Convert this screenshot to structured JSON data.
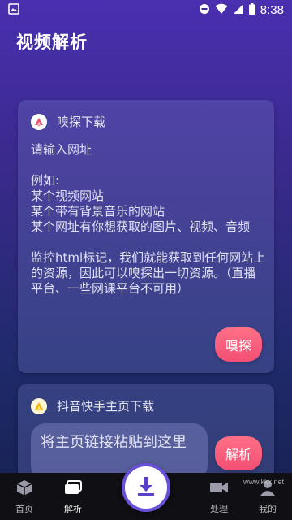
{
  "status_bar": {
    "time": "8:38"
  },
  "header": {
    "title": "视频解析"
  },
  "sniff_card": {
    "title": "嗅探下载",
    "body": "请输入网址\n\n例如:\n某个视频网站\n某个带有背景音乐的网站\n某个网址有你想获取的图片、视频、音频\n\n监控html标记，我们就能获取到任何网站上的资源，因此可以嗅探出一切资源。（直播平台、一些网课平台不可用）",
    "button_label": "嗅探"
  },
  "douyin_card": {
    "title": "抖音快手主页下载",
    "input_placeholder": "将主页链接粘贴到这里",
    "button_label": "解析"
  },
  "bottom_nav": {
    "items": [
      {
        "label": "首页"
      },
      {
        "label": "解析"
      },
      {
        "label": "处理"
      },
      {
        "label": "我的"
      }
    ]
  },
  "watermark": "www.kkx.net",
  "colors": {
    "accent": "#f24f74",
    "nav_bg": "#0f0f14",
    "fab_ring": "#6a4fd8"
  }
}
